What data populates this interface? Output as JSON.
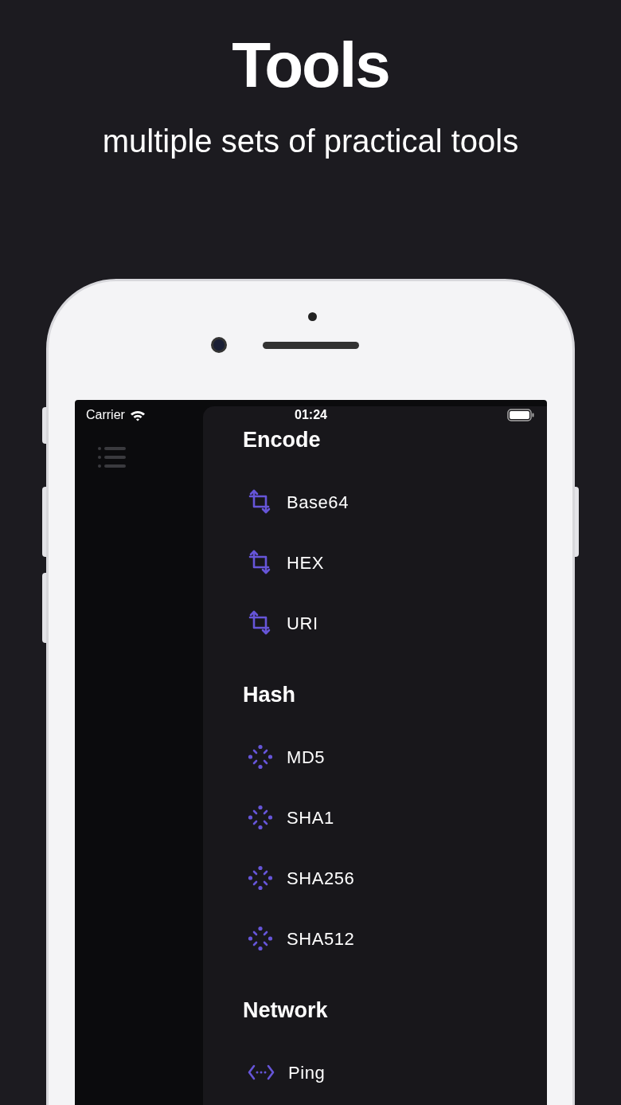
{
  "headline": "Tools",
  "subtitle": "multiple sets of practical tools",
  "status_bar": {
    "carrier": "Carrier",
    "time": "01:24"
  },
  "sections": [
    {
      "title": "Encode",
      "items": [
        {
          "label": "Base64"
        },
        {
          "label": "HEX"
        },
        {
          "label": "URI"
        }
      ]
    },
    {
      "title": "Hash",
      "items": [
        {
          "label": "MD5"
        },
        {
          "label": "SHA1"
        },
        {
          "label": "SHA256"
        },
        {
          "label": "SHA512"
        }
      ]
    },
    {
      "title": "Network",
      "items": [
        {
          "label": "Ping"
        }
      ]
    }
  ]
}
